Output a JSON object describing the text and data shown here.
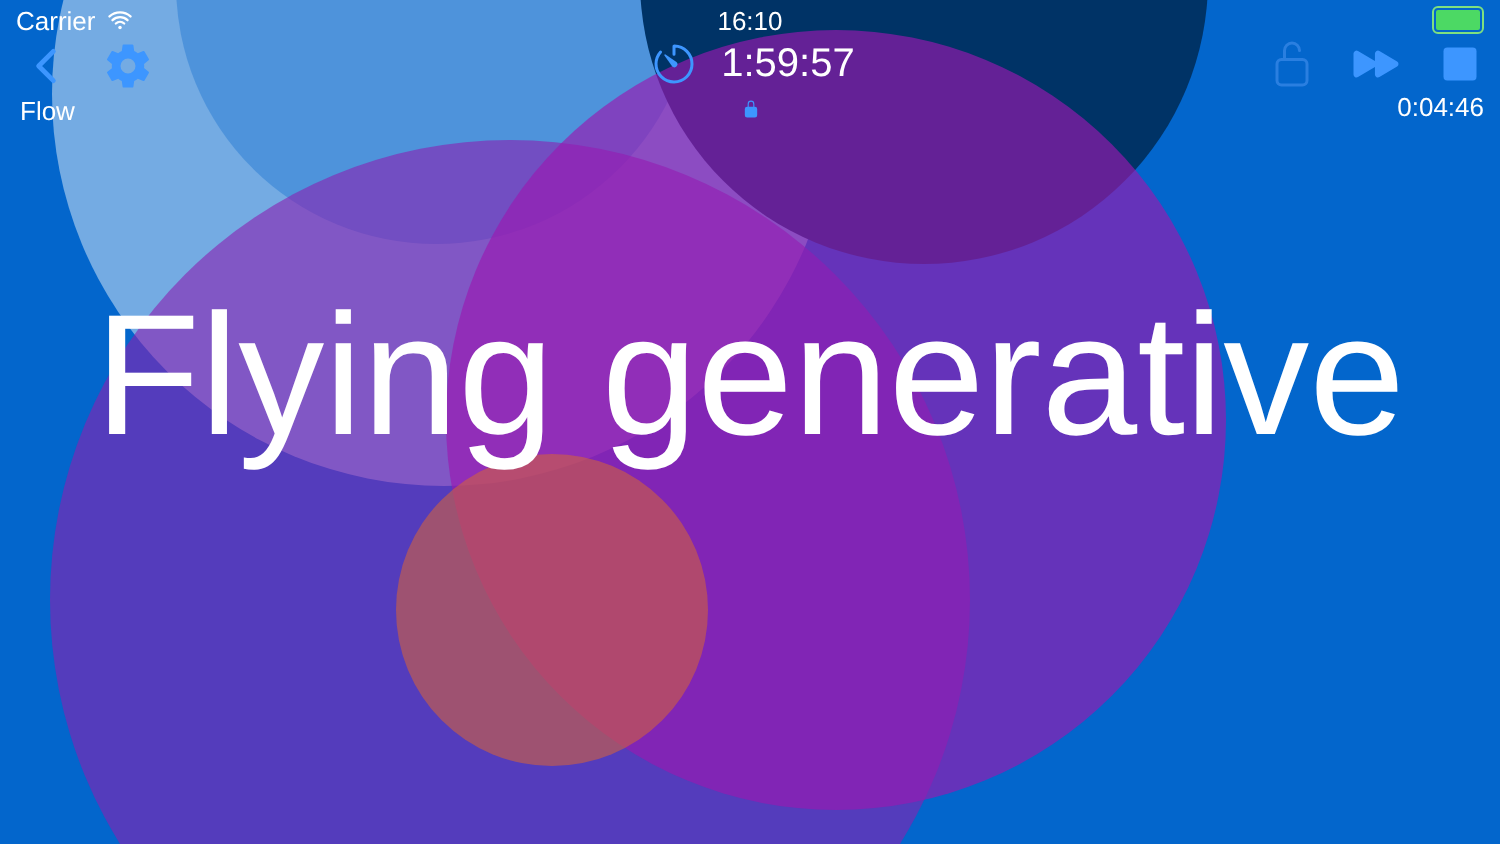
{
  "status_bar": {
    "carrier": "Carrier",
    "time": "16:10"
  },
  "toolbar": {
    "back_label": "Flow",
    "timer": "1:59:57",
    "remaining": "0:04:46"
  },
  "title": "Flying generative"
}
